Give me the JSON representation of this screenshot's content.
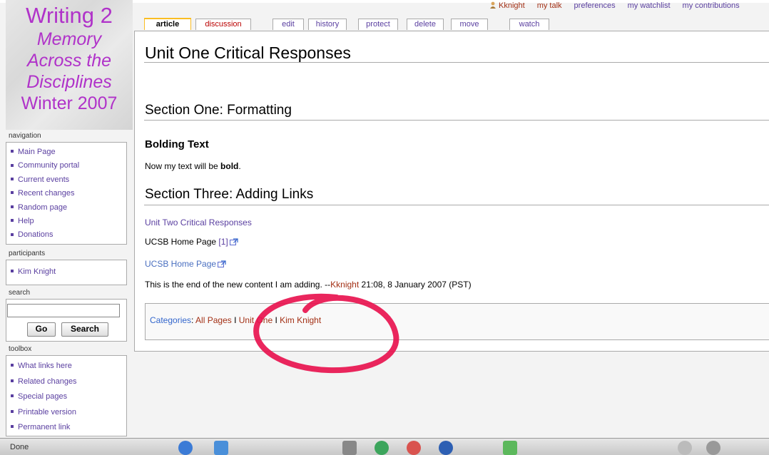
{
  "logo": {
    "line1": "Writing 2",
    "line2": "Memory",
    "line3": "Across the",
    "line4": "Disciplines",
    "line5": "Winter 2007"
  },
  "personal": {
    "user": "Kknight",
    "my_talk": "my talk",
    "preferences": "preferences",
    "watchlist": "my watchlist",
    "contributions": "my contributions"
  },
  "tabs": {
    "article": "article",
    "discussion": "discussion",
    "edit": "edit",
    "history": "history",
    "protect": "protect",
    "delete": "delete",
    "move": "move",
    "watch": "watch"
  },
  "page": {
    "title": "Unit One Critical Responses",
    "section1": "Section One: Formatting",
    "sub1": "Bolding Text",
    "bold_prefix": "Now my text will be ",
    "bold_word": "bold",
    "bold_suffix": ".",
    "section3": "Section Three: Adding Links",
    "link_unit2": "Unit Two Critical Responses",
    "ucsb1_text": "UCSB Home Page ",
    "ucsb1_ref": "[1]",
    "ucsb2_link": "UCSB Home Page",
    "end_text": "This is the end of the new content I am adding. --",
    "end_user": "Kknight",
    "end_time": " 21:08, 8 January 2007 (PST)"
  },
  "categories": {
    "label": "Categories",
    "colon": ": ",
    "items": [
      "All Pages",
      "Unit One",
      "Kim Knight"
    ],
    "sep": " I "
  },
  "sidebar": {
    "navigation": {
      "label": "navigation",
      "items": [
        "Main Page",
        "Community portal",
        "Current events",
        "Recent changes",
        "Random page",
        "Help",
        "Donations"
      ]
    },
    "participants": {
      "label": "participants",
      "items": [
        "Kim Knight"
      ]
    },
    "search": {
      "label": "search",
      "go": "Go",
      "search": "Search"
    },
    "toolbox": {
      "label": "toolbox",
      "items": [
        "What links here",
        "Related changes",
        "Special pages",
        "Printable version",
        "Permanent link"
      ]
    }
  },
  "status": {
    "text": "Done"
  },
  "colors": {
    "link": "#5a3fa0",
    "new_link": "#a33015",
    "annotation": "#e8134f",
    "logo_text": "#b032c9"
  }
}
